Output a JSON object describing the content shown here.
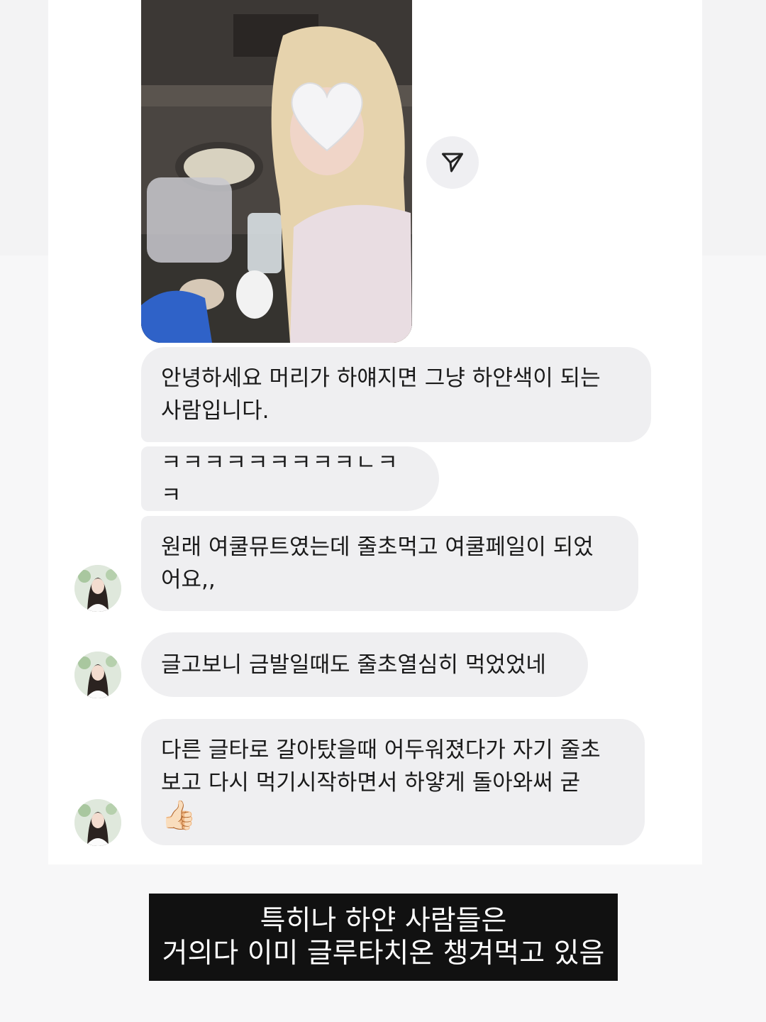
{
  "messages": {
    "m1": "안녕하세요 머리가 하얘지면 그냥 하얀색이 되는\n사람입니다.",
    "m2": "ㅋㅋㅋㅋㅋㅋㅋㅋㅋㄴㅋㅋ",
    "m3": "원래 여쿨뮤트였는데 줄초먹고 여쿨페일이 되었\n어요,,",
    "m4": "글고보니 금발일때도 줄초열심히 먹었었네",
    "m5": "다른 글타로 갈아탔을때 어두워졌다가 자기 줄초\n보고 다시 먹기시작하면서 하얗게 돌아와써 굳",
    "m5_emoji": "👍🏻"
  },
  "caption": {
    "line1": "특히나 하얀 사람들은",
    "line2": "거의다 이미 글루타치온 챙겨먹고 있음"
  },
  "icons": {
    "share": "paper-plane-icon",
    "photo_sticker": "white-heart-icon"
  },
  "colors": {
    "bubble": "#efeff1",
    "caption_bg": "#111111"
  }
}
